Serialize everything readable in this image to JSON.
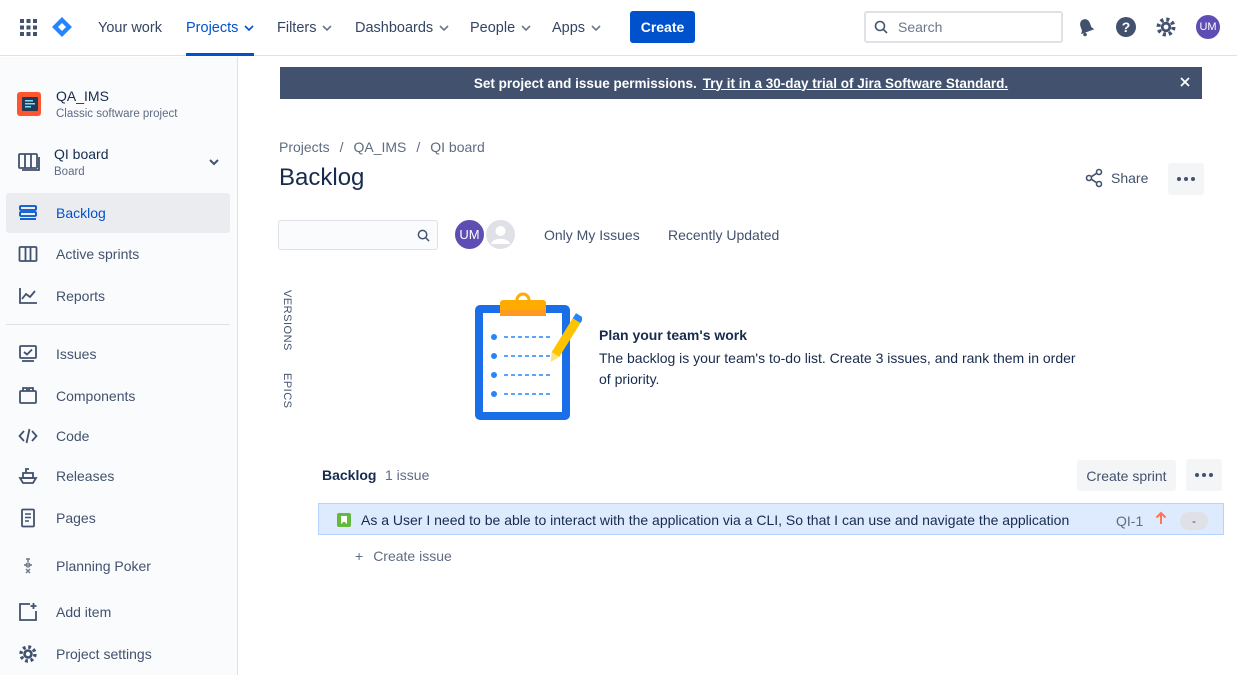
{
  "topnav": {
    "items": [
      {
        "label": "Your work",
        "has_menu": false
      },
      {
        "label": "Projects",
        "has_menu": true,
        "active": true
      },
      {
        "label": "Filters",
        "has_menu": true
      },
      {
        "label": "Dashboards",
        "has_menu": true
      },
      {
        "label": "People",
        "has_menu": true
      },
      {
        "label": "Apps",
        "has_menu": true
      }
    ],
    "create_label": "Create",
    "search_placeholder": "Search",
    "user_initials": "UM",
    "accent_color": "#0052cc"
  },
  "sidebar": {
    "project_name": "QA_IMS",
    "project_type": "Classic software project",
    "board_name": "QI board",
    "board_type": "Board",
    "items": [
      {
        "label": "Backlog",
        "icon": "backlog-icon",
        "active": true
      },
      {
        "label": "Active sprints",
        "icon": "columns-icon"
      },
      {
        "label": "Reports",
        "icon": "chart-line-icon"
      },
      {
        "label": "Issues",
        "icon": "issues-icon"
      },
      {
        "label": "Components",
        "icon": "components-icon"
      },
      {
        "label": "Code",
        "icon": "code-icon"
      },
      {
        "label": "Releases",
        "icon": "ship-icon"
      },
      {
        "label": "Pages",
        "icon": "page-icon"
      },
      {
        "label": "Planning Poker",
        "icon": "poker-icon"
      },
      {
        "label": "Add item",
        "icon": "add-item-icon"
      },
      {
        "label": "Project settings",
        "icon": "gear-icon"
      }
    ]
  },
  "banner": {
    "text": "Set project and issue permissions.",
    "link": "Try it in a 30-day trial of Jira Software Standard."
  },
  "breadcrumbs": [
    "Projects",
    "QA_IMS",
    "QI board"
  ],
  "page_title": "Backlog",
  "share_label": "Share",
  "filters": {
    "avatar_initials": "UM",
    "quick_filters": [
      "Only My Issues",
      "Recently Updated"
    ]
  },
  "side_tabs": [
    "VERSIONS",
    "EPICS"
  ],
  "empty_state": {
    "title": "Plan your team's work",
    "description": "The backlog is your team's to-do list. Create 3 issues, and rank them in order of priority."
  },
  "backlog": {
    "title": "Backlog",
    "count": "1 issue",
    "create_sprint_label": "Create sprint",
    "issues": [
      {
        "summary": "As a User I need to be able to interact with the application via a CLI, So that I can use and navigate the application",
        "key": "QI-1",
        "estimate": "-",
        "type_color": "#63ba3c",
        "priority_color": "#ff7452"
      }
    ],
    "create_issue_label": "Create issue"
  }
}
